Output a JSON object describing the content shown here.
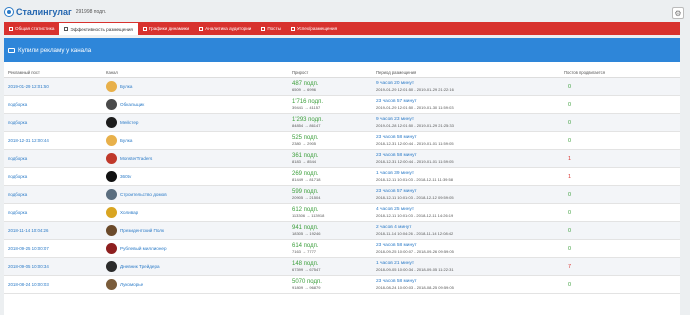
{
  "header": {
    "title": "Сталингулаг",
    "subscribers": "291998 подп."
  },
  "tabs": [
    {
      "label": "Общая статистика",
      "active": false
    },
    {
      "label": "Эффективность размещения",
      "active": true
    },
    {
      "label": "Графики динамики",
      "active": false
    },
    {
      "label": "Аналитика аудитории",
      "active": false
    },
    {
      "label": "Посты",
      "active": false
    },
    {
      "label": "Успех/размещения",
      "active": false
    }
  ],
  "panel": {
    "title": "Купили рекламу у канала"
  },
  "table": {
    "columns": [
      "Рекламный пост",
      "Канал",
      "Прирост",
      "Период размещения",
      "Постов продвигается"
    ],
    "rows": [
      {
        "post": "2019-01-29 12:01:50",
        "channel": "Булка",
        "avatar": "#e8b04a",
        "gain": "487 подп.",
        "gain_detail": "6509 → 6996",
        "duration": "9 часов 20 минут",
        "period": "2019-01-29 12:01:50 - 2019-01-29 21:22:16",
        "count": "0",
        "count_color": "green"
      },
      {
        "post": "подборка",
        "channel": "Обкальщик",
        "avatar": "#4a4a4a",
        "gain": "1'716 подп.",
        "gain_detail": "39441 → 41157",
        "duration": "23 часов 57 минут",
        "period": "2019-01-29 12:01:50 - 2019-01-30 11:59:03",
        "count": "0",
        "count_color": "green"
      },
      {
        "post": "подборка",
        "channel": "Мейстер",
        "avatar": "#1d1d1d",
        "gain": "1'293 подп.",
        "gain_detail": "84854 → 86147",
        "duration": "9 часов 23 минут",
        "period": "2019-01-28 12:01:50 - 2019-01-29 21:25:33",
        "count": "0",
        "count_color": "green"
      },
      {
        "post": "2018-12-31 12:00:44",
        "channel": "Булка",
        "avatar": "#e8b04a",
        "gain": "525 подп.",
        "gain_detail": "2380 → 2905",
        "duration": "23 часов 58 минут",
        "period": "2018-12-31 12:00:44 - 2019-01-01 11:59:05",
        "count": "0",
        "count_color": "green"
      },
      {
        "post": "подборка",
        "channel": "MonsterTraders",
        "avatar": "#c0392b",
        "gain": "361 подп.",
        "gain_detail": "8183 → 8544",
        "duration": "23 часов 58 минут",
        "period": "2018-12-31 12:00:44 - 2019-01-01 11:59:05",
        "count": "1",
        "count_color": "red"
      },
      {
        "post": "подборка",
        "channel": "360tv",
        "avatar": "#111111",
        "gain": "269 подп.",
        "gain_detail": "81449 → 81718",
        "duration": "1 часов 39 минут",
        "period": "2018-12-11 10:01:03 - 2018-12-11 11:39:58",
        "count": "1",
        "count_color": "red"
      },
      {
        "post": "подборка",
        "channel": "Строительство домов",
        "avatar": "#5b6e7f",
        "gain": "599 подп.",
        "gain_detail": "20905 → 21504",
        "duration": "23 часов 57 минут",
        "period": "2018-12-11 10:01:03 - 2018-12-12 09:59:05",
        "count": "0",
        "count_color": "green"
      },
      {
        "post": "подборка",
        "channel": "Холивар",
        "avatar": "#d9a521",
        "gain": "612 подп.",
        "gain_detail": "113306 → 113918",
        "duration": "4 часов 25 минут",
        "period": "2018-12-11 10:01:03 - 2018-12-11 14:26:19",
        "count": "0",
        "count_color": "green"
      },
      {
        "post": "2018-11-14 10:04:26",
        "channel": "Президентский Полк",
        "avatar": "#6b4a2a",
        "gain": "941 подп.",
        "gain_detail": "18305 → 19246",
        "duration": "2 часов 4 минут",
        "period": "2018-11-14 10:04:26 - 2018-11-14 12:08:42",
        "count": "0",
        "count_color": "green"
      },
      {
        "post": "2018-09-25 10:00:07",
        "channel": "Рублевый миллионер",
        "avatar": "#8e1f1f",
        "gain": "614 подп.",
        "gain_detail": "7163 → 7777",
        "duration": "23 часов 58 минут",
        "period": "2018-09-25 10:00:07 - 2018-09-26 09:59:05",
        "count": "0",
        "count_color": "green"
      },
      {
        "post": "2018-09-05 10:00:34",
        "channel": "Дневник Трейдера",
        "avatar": "#2b2b2b",
        "gain": "148 подп.",
        "gain_detail": "67399 → 67547",
        "duration": "1 часов 21 минут",
        "period": "2018-09-05 10:00:34 - 2018-09-05 11:22:31",
        "count": "7",
        "count_color": "red"
      },
      {
        "post": "2018-08-24 10:00:03",
        "channel": "Лукоморье",
        "avatar": "#7a5c3a",
        "gain": "5070 подп.",
        "gain_detail": "91809 → 96879",
        "duration": "23 часов 58 минут",
        "period": "2018-08-24 10:00:03 - 2018-08-25 09:59:05",
        "count": "0",
        "count_color": "green"
      }
    ]
  }
}
